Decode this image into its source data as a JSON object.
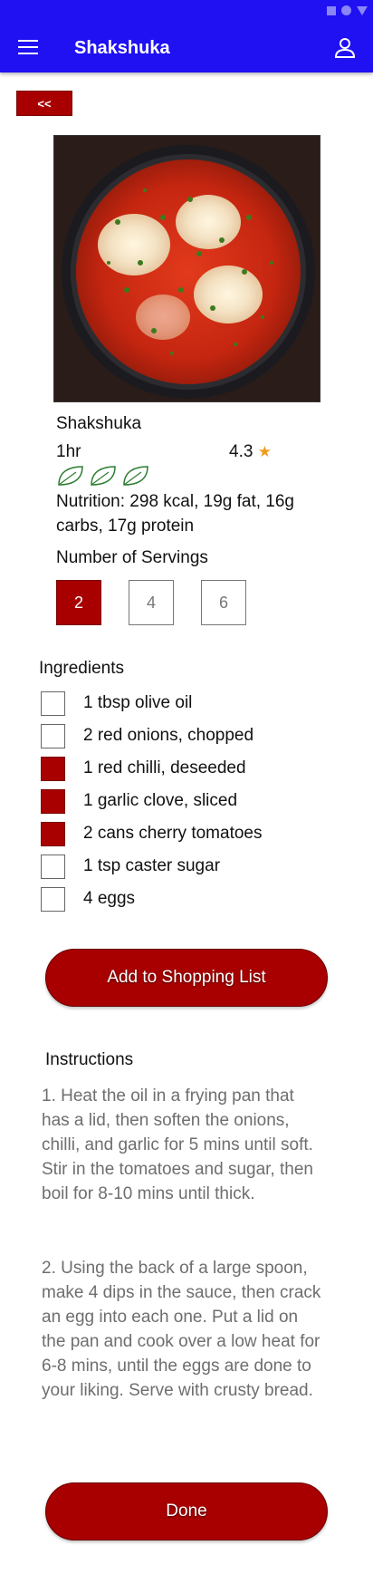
{
  "app_bar": {
    "title": "Shakshuka"
  },
  "back_button": {
    "label": "<<"
  },
  "recipe": {
    "name": "Shakshuka",
    "time": "1hr",
    "rating": "4.3",
    "star": "★",
    "leaf_count": 3,
    "nutrition": "Nutrition: 298 kcal, 19g fat, 16g carbs, 17g protein"
  },
  "servings": {
    "label": "Number of Servings",
    "options": [
      "2",
      "4",
      "6"
    ],
    "selected": "2"
  },
  "ingredients": {
    "label": "Ingredients",
    "items": [
      {
        "text": "1 tbsp olive oil",
        "checked": false
      },
      {
        "text": "2 red onions, chopped",
        "checked": false
      },
      {
        "text": "1 red chilli, deseeded",
        "checked": true
      },
      {
        "text": "1 garlic clove, sliced",
        "checked": true
      },
      {
        "text": "2 cans cherry tomatoes",
        "checked": true
      },
      {
        "text": "1 tsp caster sugar",
        "checked": false
      },
      {
        "text": "4 eggs",
        "checked": false
      }
    ]
  },
  "shopping_button": {
    "label": "Add to Shopping List"
  },
  "instructions": {
    "label": "Instructions",
    "steps": [
      "1.    Heat the oil in a frying pan that has a lid, then soften the onions, chilli, and garlic for 5 mins until soft. Stir in the tomatoes and sugar, then boil for 8-10 mins until thick.",
      "2.    Using the back of a large spoon, make 4 dips in the sauce, then crack an egg into each one. Put a lid on the pan and cook over a low heat for 6-8 mins, until the eggs are done to your liking. Serve with crusty bread."
    ]
  },
  "done_button": {
    "label": "Done"
  },
  "colors": {
    "app_bar": "#1f11f2",
    "accent": "#a80000",
    "star": "#f29c1f",
    "leaf": "#2e7d32"
  }
}
